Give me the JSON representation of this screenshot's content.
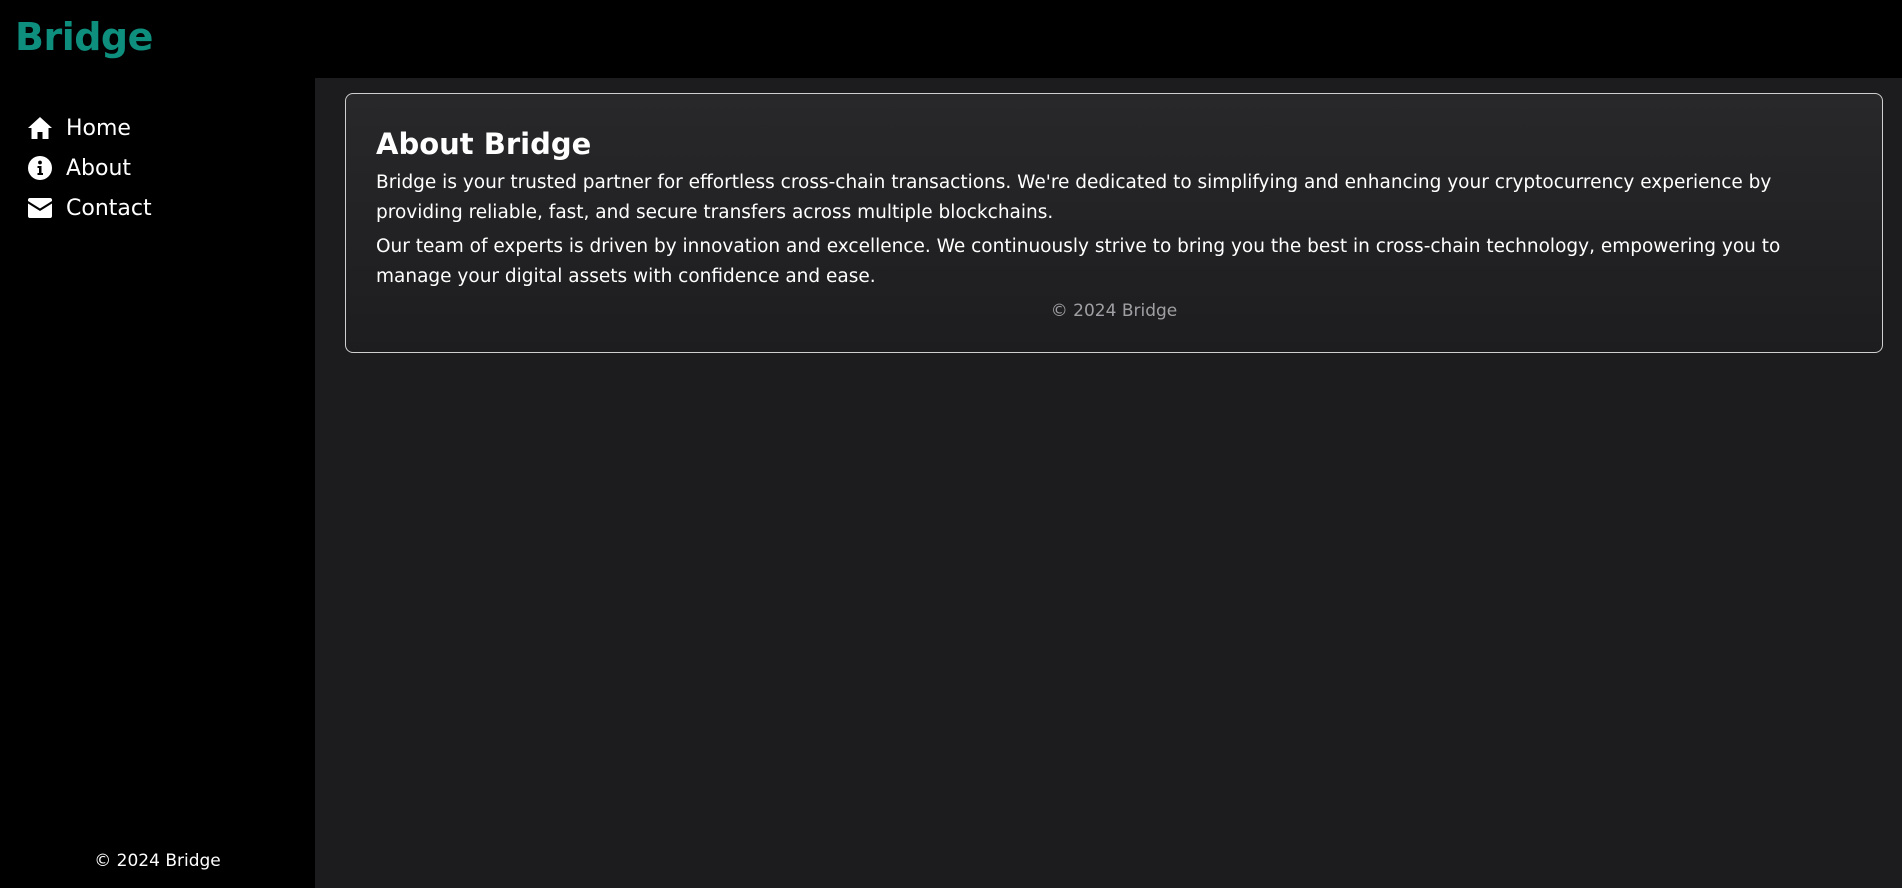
{
  "brand": {
    "name": "Bridge",
    "color": "#0e8f7e"
  },
  "sidebar": {
    "items": [
      {
        "label": "Home",
        "icon": "home-icon"
      },
      {
        "label": "About",
        "icon": "info-icon"
      },
      {
        "label": "Contact",
        "icon": "envelope-icon"
      }
    ],
    "footer": "© 2024 Bridge"
  },
  "main": {
    "card": {
      "title": "About Bridge",
      "paragraphs": [
        "Bridge is your trusted partner for effortless cross-chain transactions. We're dedicated to simplifying and enhancing your cryptocurrency experience by providing reliable, fast, and secure transfers across multiple blockchains.",
        "Our team of experts is driven by innovation and excellence. We continuously strive to bring you the best in cross-chain technology, empowering you to manage your digital assets with confidence and ease."
      ],
      "footer": "© 2024 Bridge"
    }
  },
  "colors": {
    "background": "#000000",
    "main_background": "#1c1c1e",
    "accent": "#0e8f7e",
    "muted_text": "#a0a0a4"
  }
}
